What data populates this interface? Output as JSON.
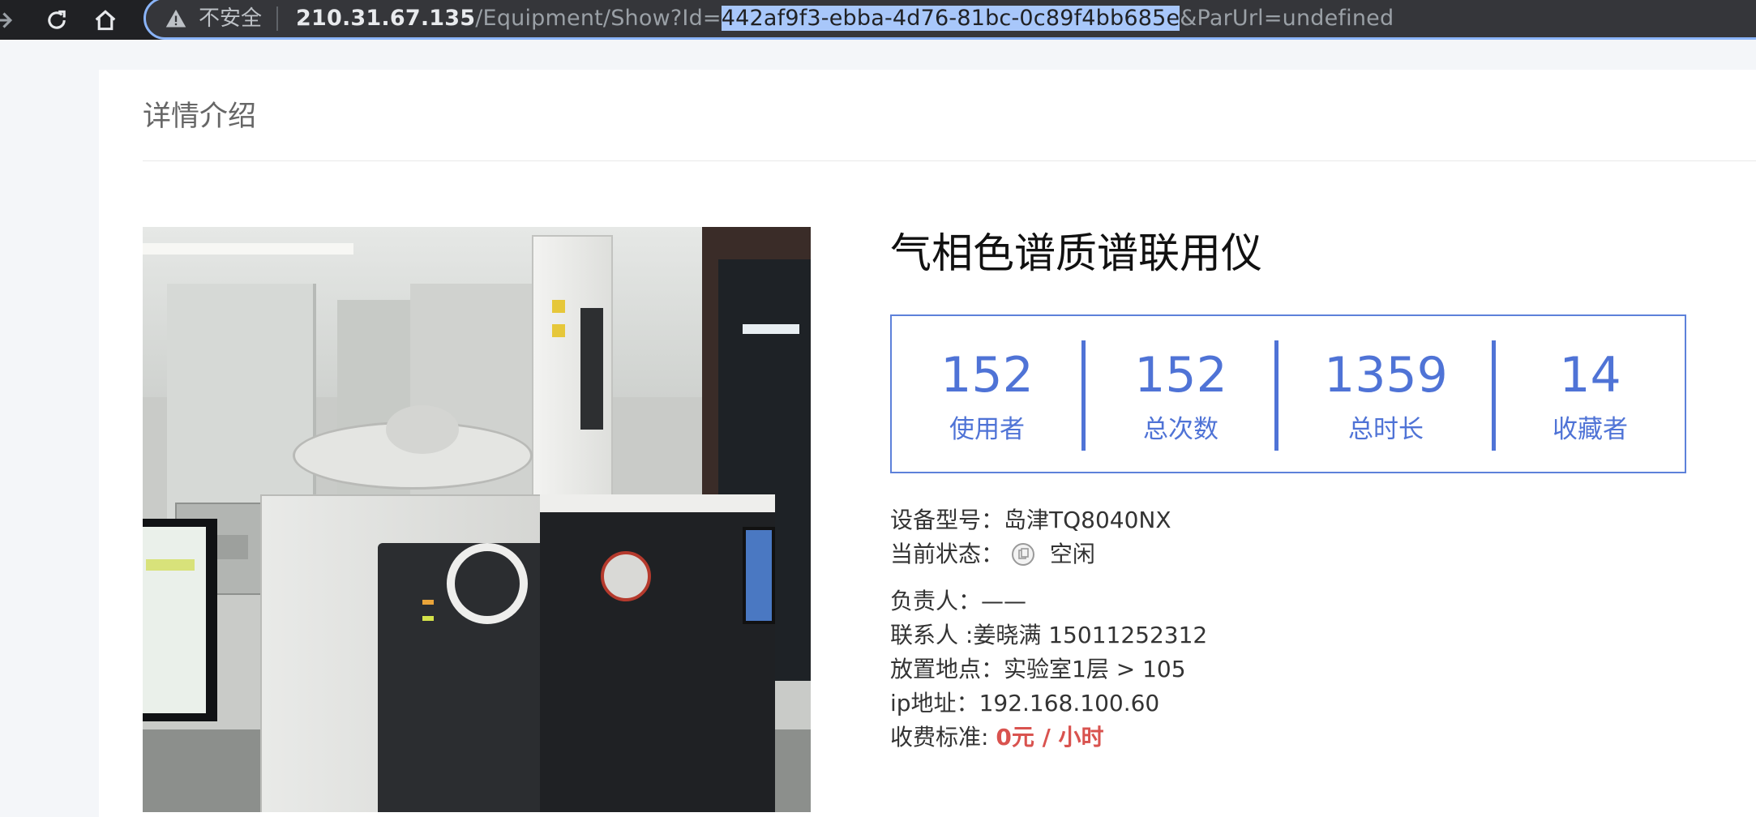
{
  "browser": {
    "insecure_label": "不安全",
    "url_host": "210.31.67.135",
    "url_path_prefix": "/Equipment/Show?Id=",
    "url_id": "442af9f3-ebba-4d76-81bc-0c89f4bb685e",
    "url_suffix": "&ParUrl=undefined",
    "accent_color": "#8ab4f8"
  },
  "page": {
    "section_title": "详情介绍",
    "equipment_name": "气相色谱质谱联用仪",
    "photo_icon": "instrument-photo",
    "stats": [
      {
        "value": "152",
        "label": "使用者"
      },
      {
        "value": "152",
        "label": "总次数"
      },
      {
        "value": "1359",
        "label": "总时长"
      },
      {
        "value": "14",
        "label": "收藏者"
      }
    ],
    "stats_color": "#4f73d6",
    "details": {
      "model_label": "设备型号：",
      "model_value": "岛津TQ8040NX",
      "status_label": "当前状态：",
      "status_icon": "idle-status-icon",
      "status_value": "空闲",
      "owner_label": "负责人：",
      "owner_value": "——",
      "contact_label": "联系人 :",
      "contact_value": "姜晓满 15011252312",
      "location_label": "放置地点：",
      "location_value": "实验室1层 > 105",
      "ip_label": "ip地址：",
      "ip_value": "192.168.100.60",
      "fee_label": "收费标准: ",
      "fee_value": "0元 / 小时",
      "fee_color": "#d9534f"
    }
  }
}
